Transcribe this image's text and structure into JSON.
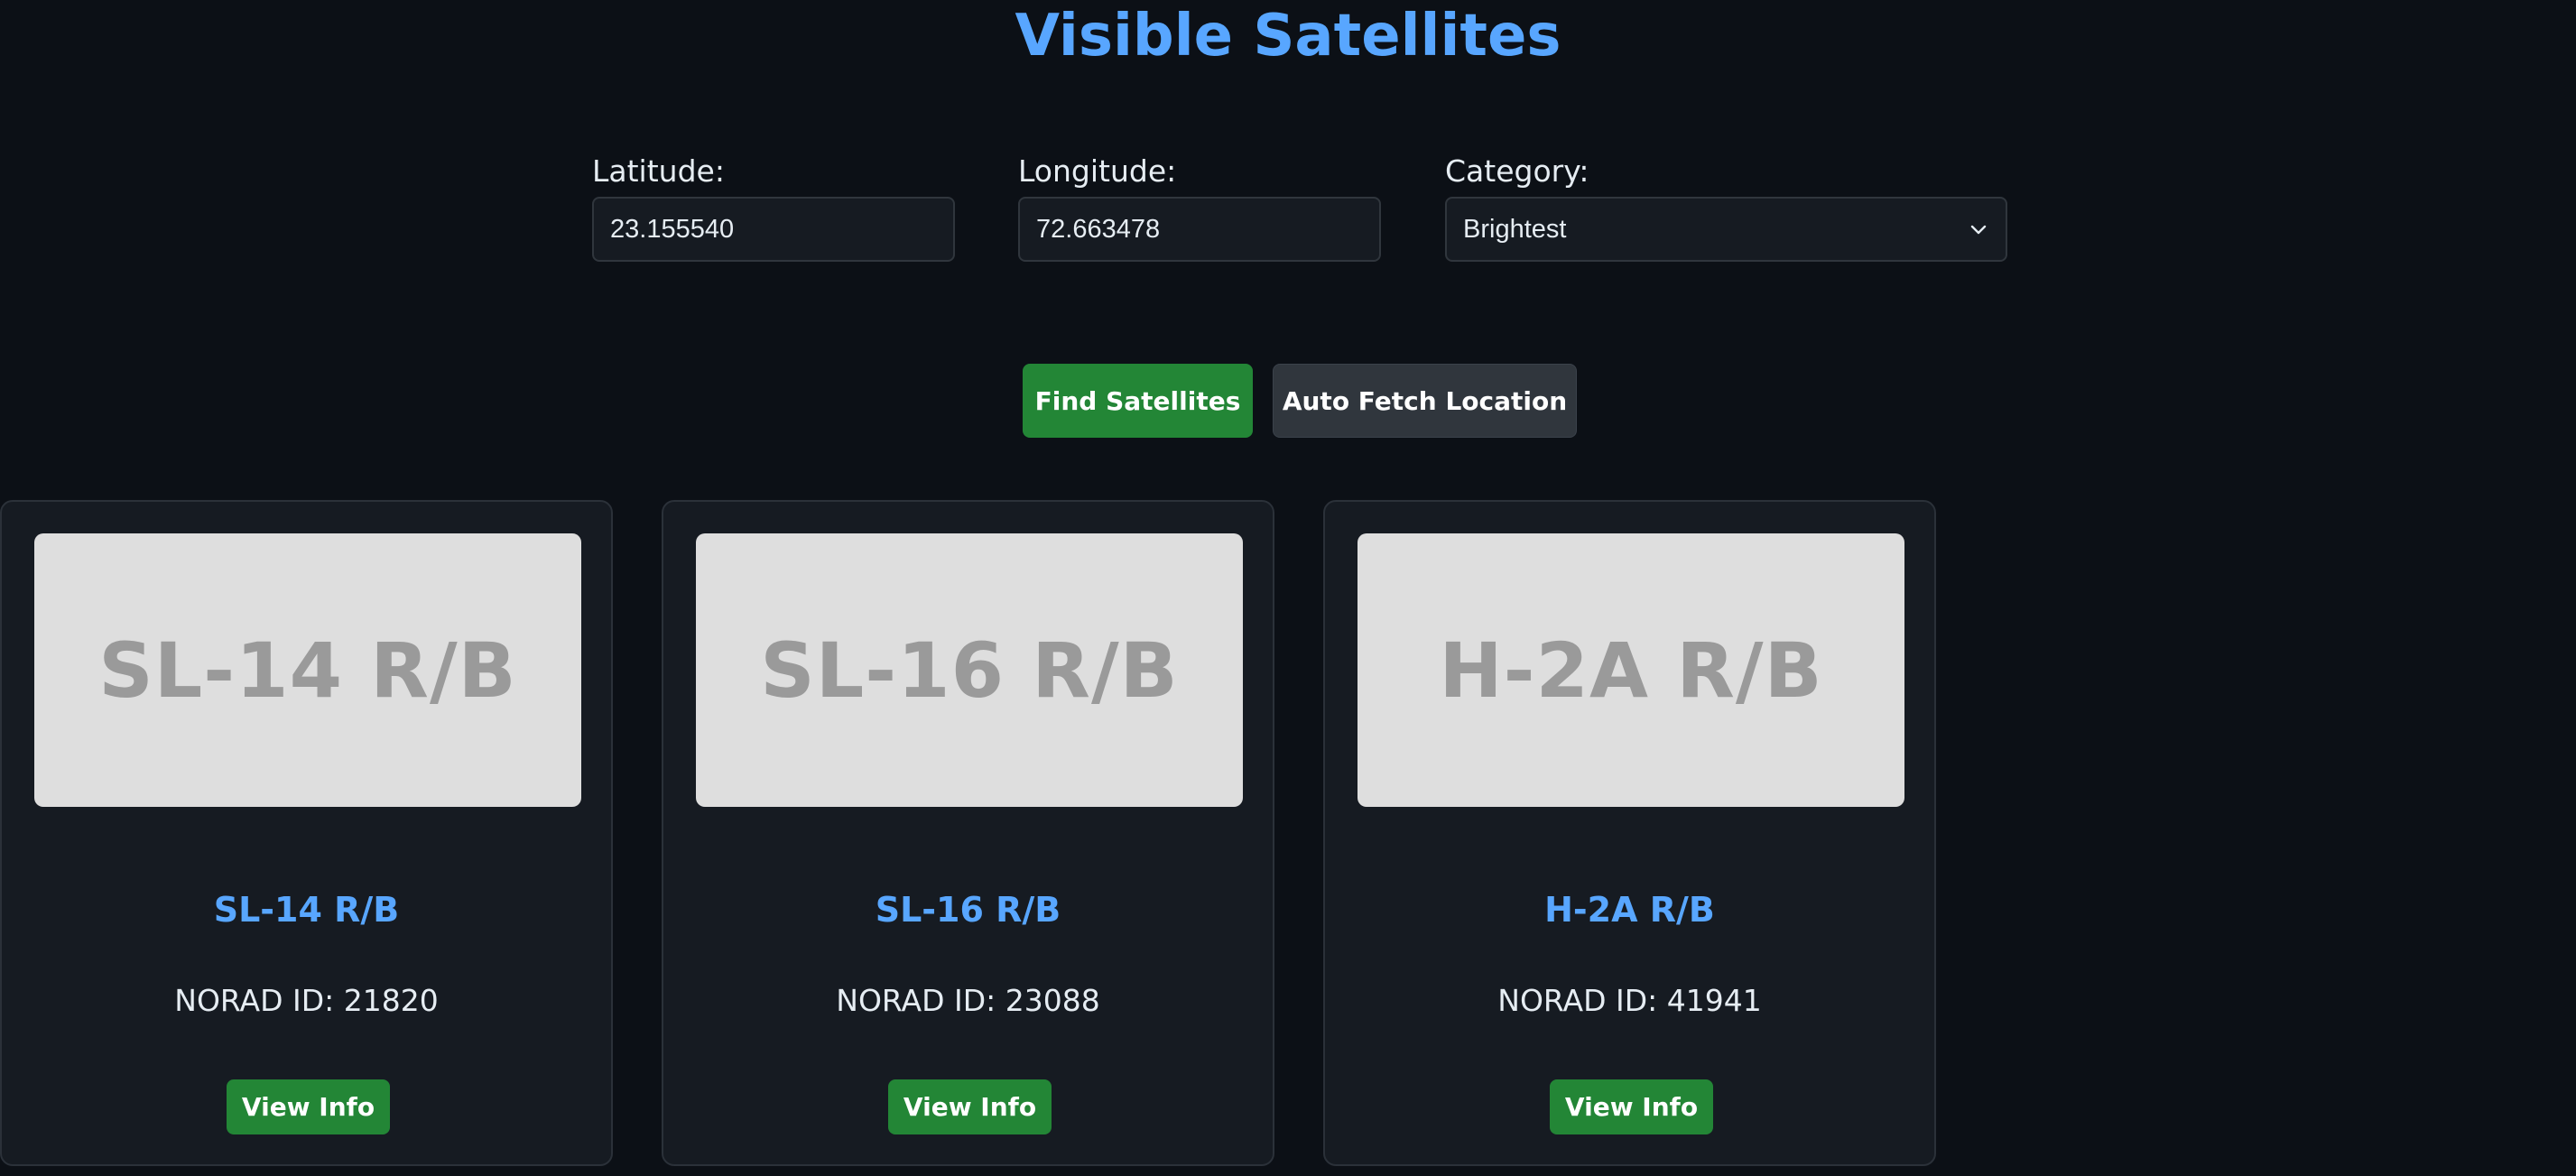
{
  "page": {
    "title": "Visible Satellites"
  },
  "form": {
    "latitude_label": "Latitude:",
    "latitude_value": "23.155540",
    "longitude_label": "Longitude:",
    "longitude_value": "72.663478",
    "category_label": "Category:",
    "category_selected": "Brightest",
    "category_icon": "chevron-down-icon"
  },
  "actions": {
    "find_label": "Find Satellites",
    "auto_fetch_label": "Auto Fetch Location"
  },
  "satellites": [
    {
      "image_text": "SL-14 R/B",
      "name": "SL-14 R/B",
      "norad": "NORAD ID: 21820",
      "button": "View Info"
    },
    {
      "image_text": "SL-16 R/B",
      "name": "SL-16 R/B",
      "norad": "NORAD ID: 23088",
      "button": "View Info"
    },
    {
      "image_text": "H-2A R/B",
      "name": "H-2A R/B",
      "norad": "NORAD ID: 41941",
      "button": "View Info"
    }
  ],
  "colors": {
    "background": "#0c1016",
    "card": "#161b22",
    "accent": "#58a6ff",
    "primary_button": "#238636",
    "secondary_button": "#30363d"
  }
}
